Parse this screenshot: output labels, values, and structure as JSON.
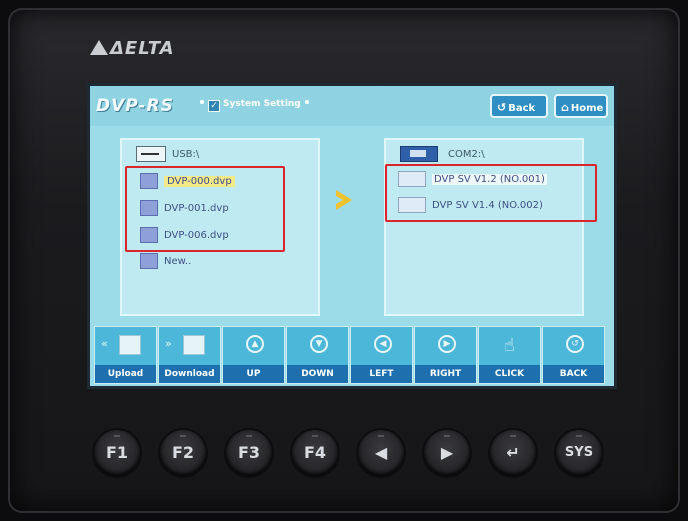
{
  "device": {
    "brand": "ΔELTA"
  },
  "screen": {
    "logo_text": "DVP-RS",
    "breadcrumb": "System Setting",
    "back_label": "Back",
    "home_label": "Home",
    "left_panel": {
      "header": "USB:\\",
      "files": [
        "DVP-000.dvp",
        "DVP-001.dvp",
        "DVP-006.dvp",
        "New.."
      ]
    },
    "right_panel": {
      "header": "COM2:\\",
      "devices": [
        "DVP SV V1.2 (NO.001)",
        "DVP SV V1.4 (NO.002)"
      ]
    },
    "toolbar": [
      "Upload",
      "Download",
      "UP",
      "DOWN",
      "LEFT",
      "RIGHT",
      "CLICK",
      "BACK"
    ]
  },
  "function_keys": [
    "F1",
    "F2",
    "F3",
    "F4",
    "◀",
    "▶",
    "↵",
    "SYS"
  ],
  "colors": {
    "screen_bg": "#9cdce8",
    "toolbar_label": "#1d6fae",
    "highlight": "#d8262b"
  }
}
